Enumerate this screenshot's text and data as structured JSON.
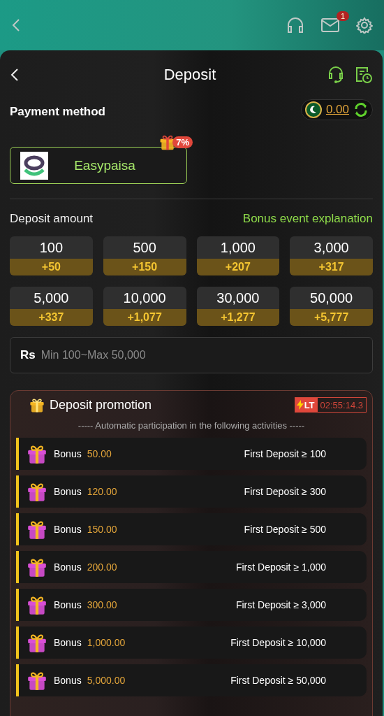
{
  "top_bar": {
    "mail_badge": "1"
  },
  "sheet": {
    "title": "Deposit"
  },
  "payment": {
    "label": "Payment method",
    "balance": "0.00",
    "methods": [
      {
        "name": "Easypaisa",
        "bonus": "7%",
        "selected": true
      }
    ]
  },
  "amount": {
    "label": "Deposit amount",
    "link": "Bonus event explanation",
    "options": [
      {
        "amount": "100",
        "bonus": "+50"
      },
      {
        "amount": "500",
        "bonus": "+150"
      },
      {
        "amount": "1,000",
        "bonus": "+207"
      },
      {
        "amount": "3,000",
        "bonus": "+317"
      },
      {
        "amount": "5,000",
        "bonus": "+337"
      },
      {
        "amount": "10,000",
        "bonus": "+1,077"
      },
      {
        "amount": "30,000",
        "bonus": "+1,277"
      },
      {
        "amount": "50,000",
        "bonus": "+5,777"
      }
    ],
    "currency": "Rs",
    "placeholder": "Min 100~Max 50,000"
  },
  "promotion": {
    "title": "Deposit promotion",
    "tag": "LT",
    "timer": "02:55:14.3",
    "subtitle": "----- Automatic participation in the following activities -----",
    "rows": [
      {
        "label": "Bonus",
        "value": "50.00",
        "condition": "First Deposit ≥ 100"
      },
      {
        "label": "Bonus",
        "value": "120.00",
        "condition": "First Deposit ≥ 300"
      },
      {
        "label": "Bonus",
        "value": "150.00",
        "condition": "First Deposit ≥ 500"
      },
      {
        "label": "Bonus",
        "value": "200.00",
        "condition": "First Deposit ≥ 1,000"
      },
      {
        "label": "Bonus",
        "value": "300.00",
        "condition": "First Deposit ≥ 3,000"
      },
      {
        "label": "Bonus",
        "value": "1,000.00",
        "condition": "First Deposit ≥ 10,000"
      },
      {
        "label": "Bonus",
        "value": "5,000.00",
        "condition": "First Deposit ≥ 50,000"
      }
    ]
  }
}
